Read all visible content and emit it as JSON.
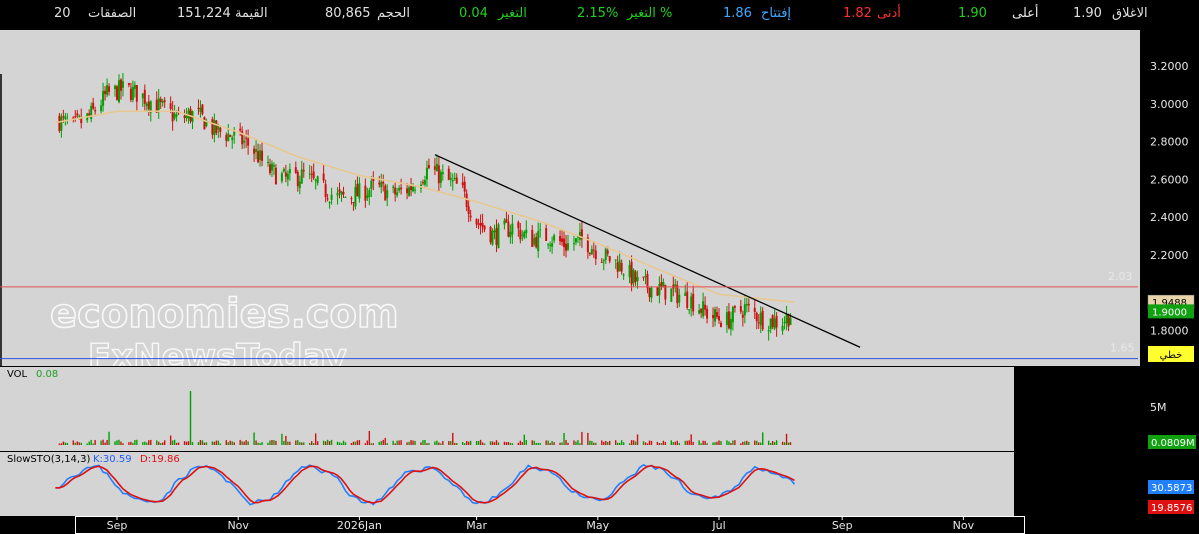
{
  "header": {
    "close_label": "الاغلاق",
    "close_value": "1.90",
    "high_label": "أعلى",
    "high_value": "1.90",
    "low_label": "أدنى",
    "low_value": "1.82",
    "open_label": "إفتتاح",
    "open_value": "1.86",
    "changepct_label": "التغير %",
    "changepct_value": "2.15%",
    "change_label": "التغير",
    "change_value": "0.04",
    "volume_label": "الحجم",
    "volume_value": "80,865",
    "value_label": "القيمة",
    "value_value": "151,224",
    "trades_label": "الصفقات",
    "trades_value": "20"
  },
  "colors": {
    "up": "#00a000",
    "down": "#d01010",
    "ma": "#e8c890",
    "trend": "#000000",
    "resistance": "#e05050",
    "support": "#3050e0",
    "k_line": "#2080ff",
    "d_line": "#e01010",
    "panel_bg": "#d4d4d4"
  },
  "watermark": {
    "line1": "economies.com",
    "line2": "FxNewsToday"
  },
  "chart_data": [
    {
      "type": "candlestick",
      "title": "",
      "x_range": [
        "2025-08-01",
        "2026-11-30"
      ],
      "y_ticks": [
        "3.2000",
        "3.0000",
        "2.8000",
        "2.6000",
        "2.4000",
        "2.2000",
        "1.8000"
      ],
      "ylim": [
        1.6,
        3.3
      ],
      "close_path": [
        [
          "2025-08-01",
          2.92
        ],
        [
          "2025-08-10",
          2.88
        ],
        [
          "2025-08-18",
          2.93
        ],
        [
          "2025-08-27",
          3.05
        ],
        [
          "2025-09-05",
          3.08
        ],
        [
          "2025-09-14",
          3.04
        ],
        [
          "2025-09-23",
          2.98
        ],
        [
          "2025-10-02",
          2.92
        ],
        [
          "2025-10-11",
          2.95
        ],
        [
          "2025-10-20",
          2.86
        ],
        [
          "2025-10-29",
          2.83
        ],
        [
          "2025-11-07",
          2.78
        ],
        [
          "2025-11-16",
          2.65
        ],
        [
          "2025-11-25",
          2.6
        ],
        [
          "2025-12-04",
          2.62
        ],
        [
          "2025-12-13",
          2.55
        ],
        [
          "2025-12-22",
          2.5
        ],
        [
          "2025-12-31",
          2.52
        ],
        [
          "2026-01-09",
          2.56
        ],
        [
          "2026-01-18",
          2.52
        ],
        [
          "2026-01-26",
          2.55
        ],
        [
          "2026-02-05",
          2.66
        ],
        [
          "2026-02-13",
          2.6
        ],
        [
          "2026-02-21",
          2.55
        ],
        [
          "2026-03-01",
          2.38
        ],
        [
          "2026-03-10",
          2.3
        ],
        [
          "2026-03-19",
          2.35
        ],
        [
          "2026-03-28",
          2.28
        ],
        [
          "2026-04-06",
          2.3
        ],
        [
          "2026-04-15",
          2.25
        ],
        [
          "2026-04-24",
          2.28
        ],
        [
          "2026-05-03",
          2.2
        ],
        [
          "2026-05-12",
          2.15
        ],
        [
          "2026-05-21",
          2.05
        ],
        [
          "2026-05-30",
          2.02
        ],
        [
          "2026-06-08",
          2.0
        ],
        [
          "2026-06-17",
          1.96
        ],
        [
          "2026-06-26",
          1.88
        ],
        [
          "2026-07-05",
          1.85
        ],
        [
          "2026-07-14",
          1.92
        ],
        [
          "2026-07-23",
          1.86
        ],
        [
          "2026-08-01",
          1.84
        ],
        [
          "2026-08-08",
          1.9
        ]
      ],
      "ma_path": [
        [
          "2025-08-01",
          2.9
        ],
        [
          "2025-09-01",
          2.96
        ],
        [
          "2025-10-01",
          2.96
        ],
        [
          "2025-11-01",
          2.85
        ],
        [
          "2025-12-01",
          2.72
        ],
        [
          "2026-01-01",
          2.62
        ],
        [
          "2026-02-01",
          2.56
        ],
        [
          "2026-03-01",
          2.48
        ],
        [
          "2026-04-01",
          2.38
        ],
        [
          "2026-05-01",
          2.26
        ],
        [
          "2026-06-01",
          2.12
        ],
        [
          "2026-07-01",
          1.99
        ],
        [
          "2026-08-08",
          1.9488
        ]
      ],
      "trendline": [
        [
          "2026-02-08",
          2.73
        ],
        [
          "2026-09-10",
          1.71
        ]
      ],
      "resistance": {
        "value": 2.03,
        "label": "2.03"
      },
      "support": {
        "value": 1.65,
        "label": "1.65"
      },
      "ma_label": "1.9488",
      "last_label": "1.9000",
      "line_tool_label": "خطي"
    },
    {
      "type": "bar",
      "title": "VOL",
      "value_label": "0.08",
      "ylim": [
        0,
        9
      ],
      "y_ticks": [
        "5M"
      ],
      "last_label": "0.0809M",
      "spike": {
        "date": "2025-10-08",
        "value": 7.2
      }
    },
    {
      "type": "line",
      "title": "SlowSTO(3,14,3)",
      "k_label": "K:30.59",
      "d_label": "D:19.86",
      "ylim": [
        0,
        100
      ],
      "k_last": "30.5873",
      "d_last": "19.8576",
      "series": [
        {
          "name": "K"
        },
        {
          "name": "D"
        }
      ]
    }
  ],
  "x_axis": {
    "ticks": [
      {
        "label": "Sep",
        "date": "2025-09-01"
      },
      {
        "label": "Nov",
        "date": "2025-11-01"
      },
      {
        "label": "2026Jan",
        "date": "2026-01-01"
      },
      {
        "label": "Mar",
        "date": "2026-03-01"
      },
      {
        "label": "May",
        "date": "2026-05-01"
      },
      {
        "label": "Jul",
        "date": "2026-07-01"
      },
      {
        "label": "Sep",
        "date": "2026-09-01"
      },
      {
        "label": "Nov",
        "date": "2026-11-01"
      }
    ]
  }
}
